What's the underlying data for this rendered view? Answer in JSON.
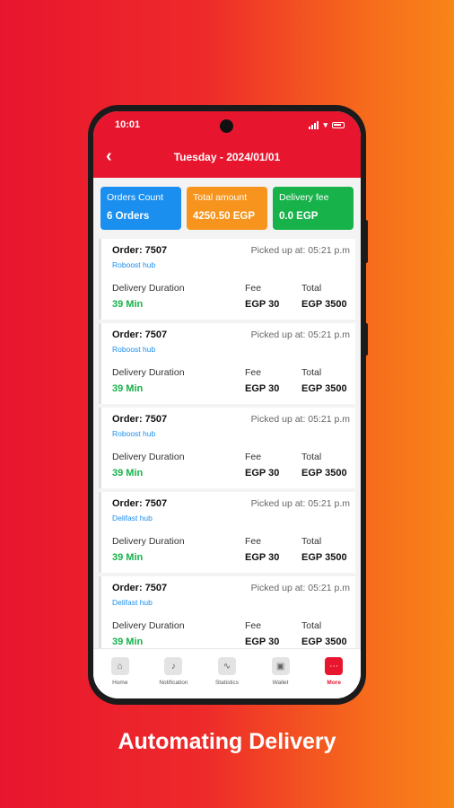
{
  "status_bar": {
    "time": "10:01"
  },
  "header": {
    "back_icon": "chevron-left-icon",
    "title": "Tuesday - 2024/01/01"
  },
  "summary": [
    {
      "label": "Orders Count",
      "value": "6 Orders",
      "color": "#1a8ff0"
    },
    {
      "label": "Total amount",
      "value": "4250.50 EGP",
      "color": "#f7941d"
    },
    {
      "label": "Delivery fee",
      "value": "0.0 EGP",
      "color": "#17b24a"
    }
  ],
  "orders": [
    {
      "order": "Order: 7507",
      "hub": "Roboost hub",
      "picked": "Picked up at: 05:21 p.m",
      "duration_label": "Delivery Duration",
      "duration": "39 Min",
      "fee_label": "Fee",
      "fee": "EGP 30",
      "total_label": "Total",
      "total": "EGP 3500"
    },
    {
      "order": "Order: 7507",
      "hub": "Roboost hub",
      "picked": "Picked up at: 05:21 p.m",
      "duration_label": "Delivery Duration",
      "duration": "39 Min",
      "fee_label": "Fee",
      "fee": "EGP 30",
      "total_label": "Total",
      "total": "EGP 3500"
    },
    {
      "order": "Order: 7507",
      "hub": "Roboost hub",
      "picked": "Picked up at: 05:21 p.m",
      "duration_label": "Delivery Duration",
      "duration": "39 Min",
      "fee_label": "Fee",
      "fee": "EGP 30",
      "total_label": "Total",
      "total": "EGP 3500"
    },
    {
      "order": "Order: 7507",
      "hub": "Delifast hub",
      "picked": "Picked up at: 05:21 p.m",
      "duration_label": "Delivery Duration",
      "duration": "39 Min",
      "fee_label": "Fee",
      "fee": "EGP 30",
      "total_label": "Total",
      "total": "EGP 3500"
    },
    {
      "order": "Order: 7507",
      "hub": "Delifast hub",
      "picked": "Picked up at: 05:21 p.m",
      "duration_label": "Delivery Duration",
      "duration": "39 Min",
      "fee_label": "Fee",
      "fee": "EGP 30",
      "total_label": "Total",
      "total": "EGP 3500"
    }
  ],
  "tabs": [
    {
      "label": "Home",
      "icon": "home-icon",
      "glyph": "⌂"
    },
    {
      "label": "Notification",
      "icon": "bell-icon",
      "glyph": "♪"
    },
    {
      "label": "Statistics",
      "icon": "chart-icon",
      "glyph": "∿"
    },
    {
      "label": "Wallet",
      "icon": "wallet-icon",
      "glyph": "▣"
    },
    {
      "label": "More",
      "icon": "more-icon",
      "glyph": "⋯",
      "active": true
    }
  ],
  "headline": "Automating Delivery",
  "colors": {
    "brand_red": "#e8152e",
    "brand_orange": "#f98518",
    "success_green": "#17b24a",
    "link_blue": "#1a8ff0"
  }
}
